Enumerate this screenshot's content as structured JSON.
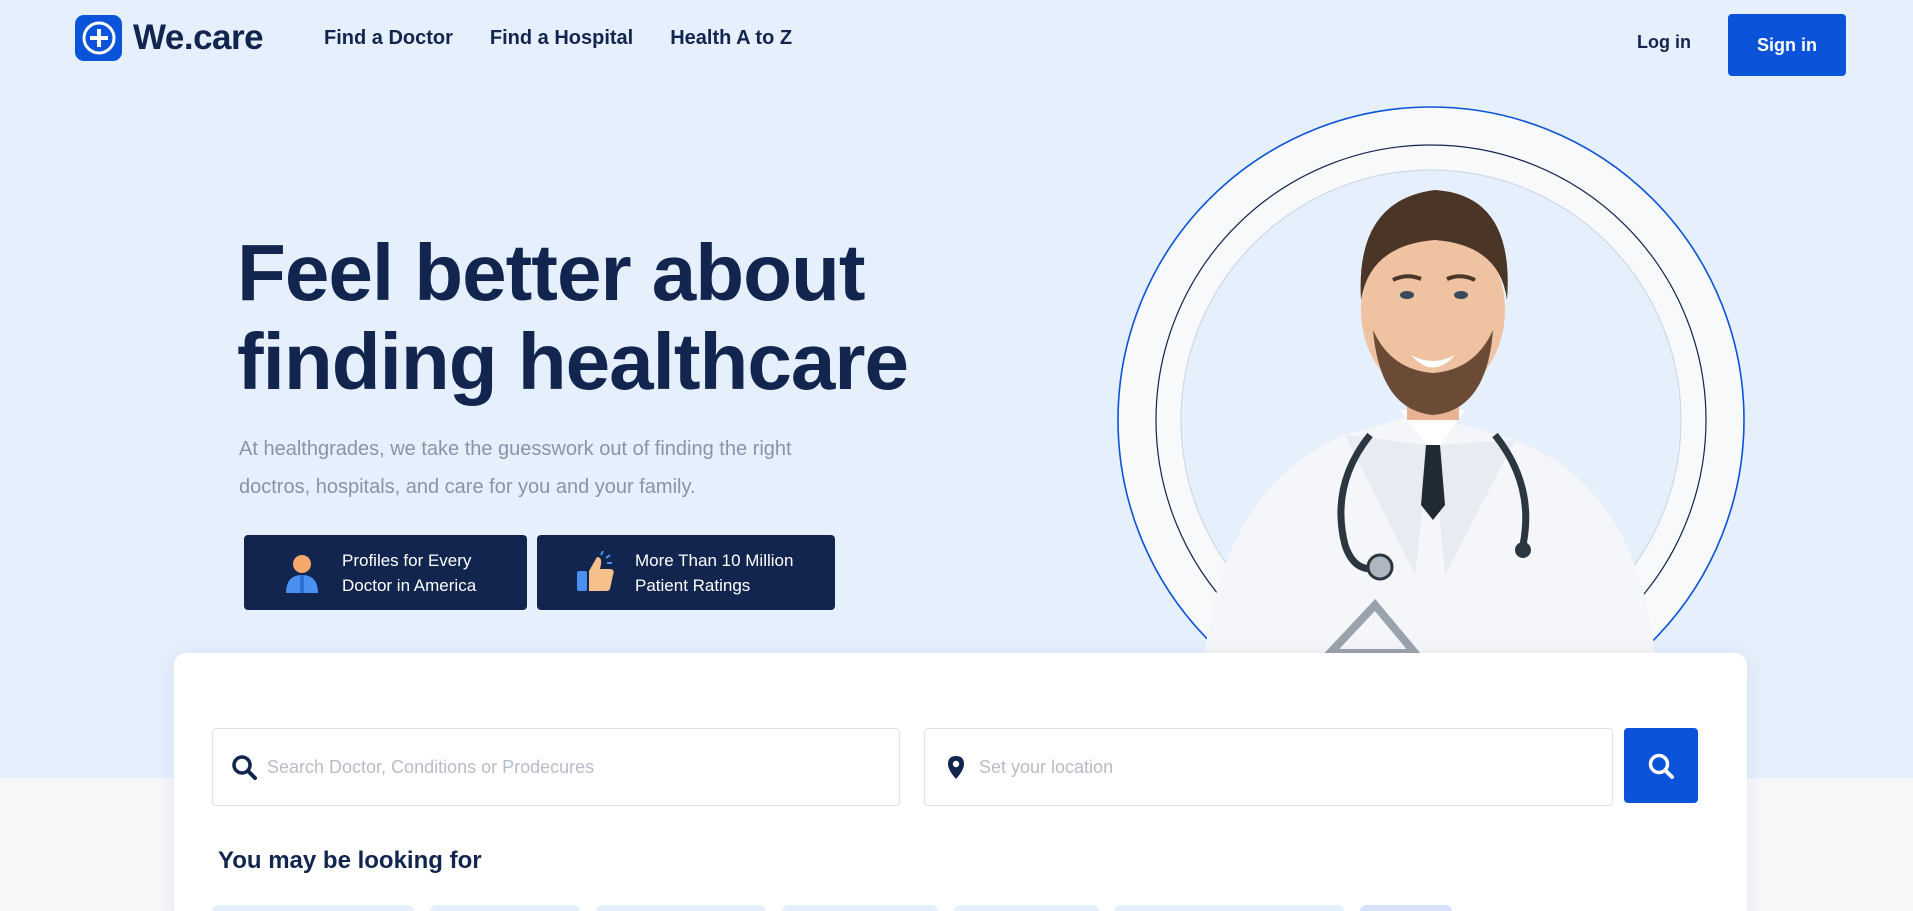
{
  "brand": {
    "name": "We.care",
    "accent": "#0b53d9",
    "dark": "#12254f",
    "hero_bg": "#e6effc"
  },
  "nav": {
    "items": [
      "Find a Doctor",
      "Find a Hospital",
      "Health A to Z"
    ],
    "login": "Log in",
    "signin": "Sign in"
  },
  "hero": {
    "title_line1": "Feel better about",
    "title_line2": "finding healthcare",
    "subtitle_line1": "At healthgrades, we take the guesswork out of finding the right",
    "subtitle_line2": "doctros, hospitals, and care for you and your family.",
    "features": [
      {
        "icon": "person-icon",
        "line1": "Profiles for Every",
        "line2": "Doctor in America"
      },
      {
        "icon": "thumbs-up-icon",
        "line1": "More Than 10 Million",
        "line2": "Patient Ratings"
      }
    ],
    "image": "doctor-portrait"
  },
  "search": {
    "doctor_placeholder": "Search Doctor, Conditions or Prodecures",
    "location_placeholder": "Set your location",
    "doctor_icon": "search-icon",
    "location_icon": "location-pin-icon",
    "button_icon": "search-icon",
    "looking_title": "You may be looking for"
  }
}
